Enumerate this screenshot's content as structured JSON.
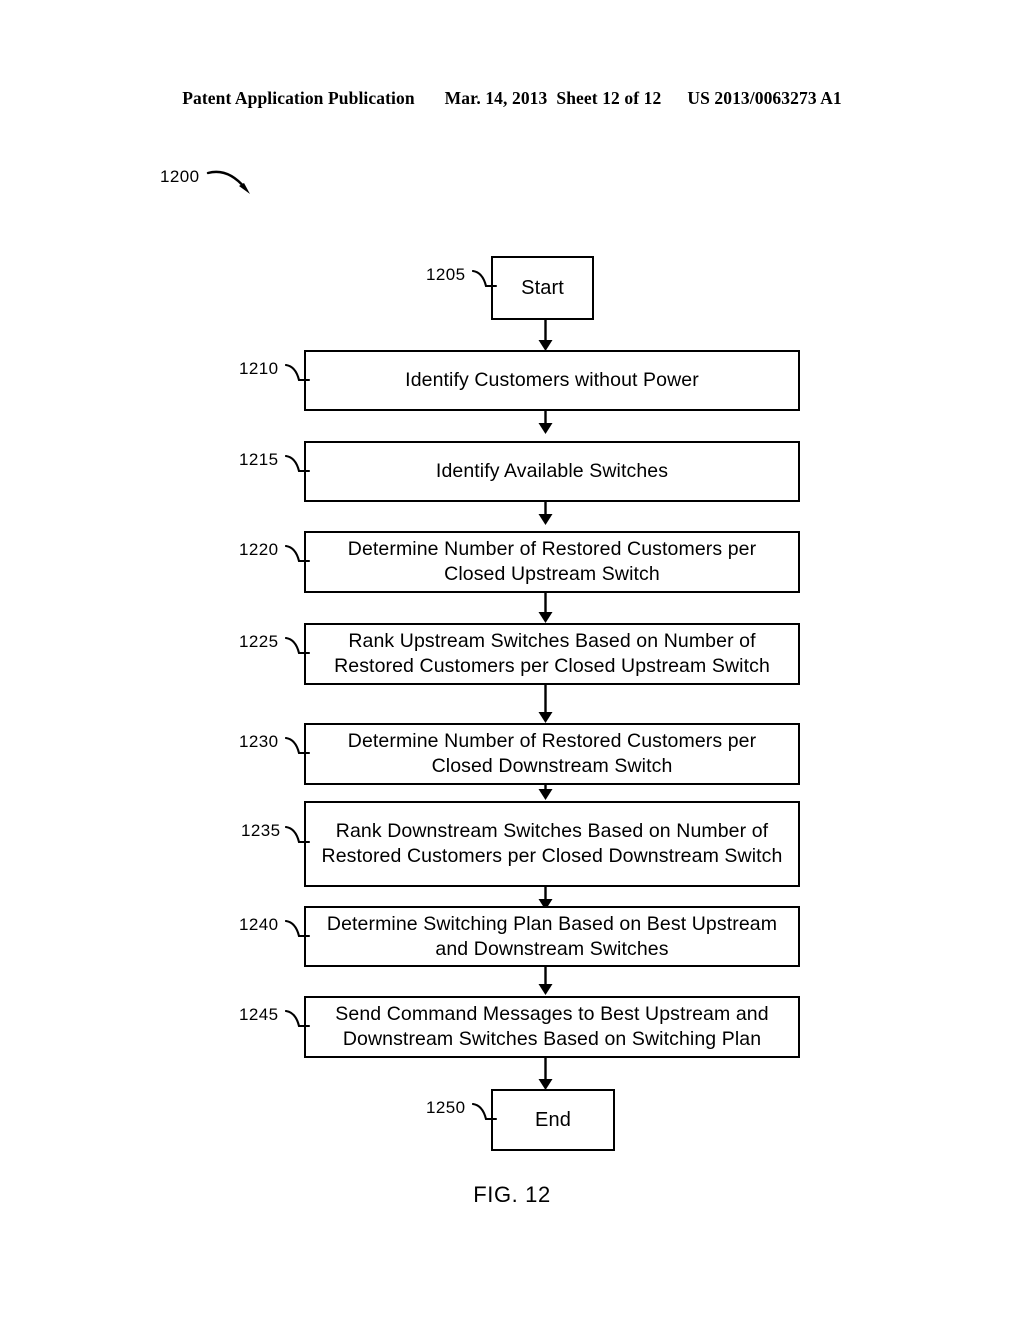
{
  "header": {
    "publication": "Patent Application Publication",
    "date": "Mar. 14, 2013",
    "sheet": "Sheet 12 of 12",
    "patent_number": "US 2013/0063273 A1"
  },
  "figure": {
    "diagram_ref": "1200",
    "caption": "FIG. 12"
  },
  "nodes": [
    {
      "ref": "1205",
      "label": "Start"
    },
    {
      "ref": "1210",
      "label": "Identify Customers without Power"
    },
    {
      "ref": "1215",
      "label": "Identify Available Switches"
    },
    {
      "ref": "1220",
      "label": "Determine Number of Restored Customers per Closed Upstream Switch"
    },
    {
      "ref": "1225",
      "label": "Rank Upstream Switches Based on Number of Restored Customers per Closed Upstream Switch"
    },
    {
      "ref": "1230",
      "label": "Determine Number of Restored Customers per Closed Downstream Switch"
    },
    {
      "ref": "1235",
      "label": "Rank Downstream Switches Based on Number of Restored Customers per Closed Downstream Switch"
    },
    {
      "ref": "1240",
      "label": "Determine Switching Plan Based on Best Upstream and Downstream Switches"
    },
    {
      "ref": "1245",
      "label": "Send Command Messages to Best Upstream and Downstream Switches Based on Switching Plan"
    },
    {
      "ref": "1250",
      "label": "End"
    }
  ],
  "colors": {
    "ink": "#000000",
    "paper": "#ffffff"
  }
}
